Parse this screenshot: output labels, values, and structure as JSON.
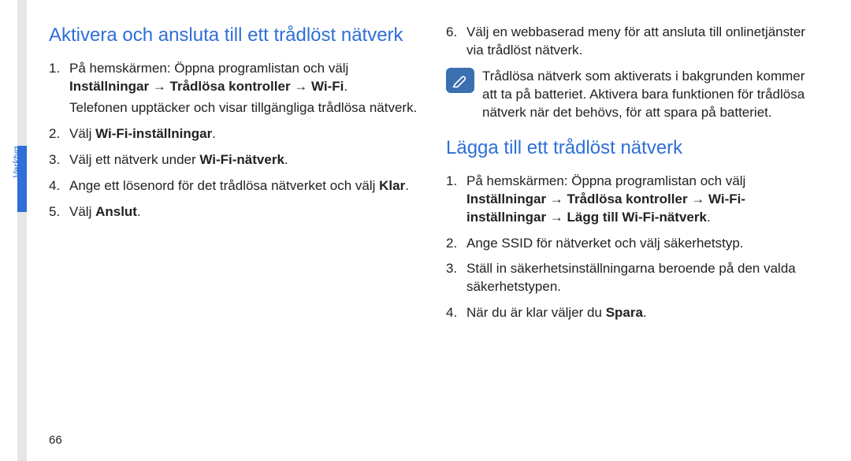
{
  "side_label": "Verktyg",
  "page_number": "66",
  "left": {
    "heading": "Aktivera och ansluta till ett trådlöst nätverk",
    "items": [
      {
        "num": "1.",
        "pre": "På hemskärmen: Öppna programlistan och välj ",
        "bold": "Inställningar → Trådlösa kontroller → Wi-Fi",
        "post": ".",
        "sub": "Telefonen upptäcker och visar tillgängliga trådlösa nätverk."
      },
      {
        "num": "2.",
        "pre": "Välj ",
        "bold": "Wi-Fi-inställningar",
        "post": "."
      },
      {
        "num": "3.",
        "pre": "Välj ett nätverk under ",
        "bold": "Wi-Fi-nätverk",
        "post": "."
      },
      {
        "num": "4.",
        "pre": "Ange ett lösenord för det trådlösa nätverket och välj ",
        "bold": "Klar",
        "post": "."
      },
      {
        "num": "5.",
        "pre": "Välj ",
        "bold": "Anslut",
        "post": "."
      }
    ]
  },
  "right": {
    "continue_items": [
      {
        "num": "6.",
        "pre": "Välj en webbaserad meny för att ansluta till onlinetjänster via trådlöst nätverk.",
        "bold": "",
        "post": ""
      }
    ],
    "note": "Trådlösa nätverk som aktiverats i bakgrunden kommer att ta på batteriet. Aktivera bara funktionen för trådlösa nätverk när det behövs, för att spara på batteriet.",
    "heading": "Lägga till ett trådlöst nätverk",
    "items": [
      {
        "num": "1.",
        "pre": "På hemskärmen: Öppna programlistan och välj ",
        "bold": "Inställningar → Trådlösa kontroller → Wi-Fi-inställningar → Lägg till Wi-Fi-nätverk",
        "post": "."
      },
      {
        "num": "2.",
        "pre": "Ange SSID för nätverket och välj säkerhetstyp.",
        "bold": "",
        "post": ""
      },
      {
        "num": "3.",
        "pre": "Ställ in säkerhetsinställningarna beroende på den valda säkerhetstypen.",
        "bold": "",
        "post": ""
      },
      {
        "num": "4.",
        "pre": "När du är klar väljer du ",
        "bold": "Spara",
        "post": "."
      }
    ]
  }
}
